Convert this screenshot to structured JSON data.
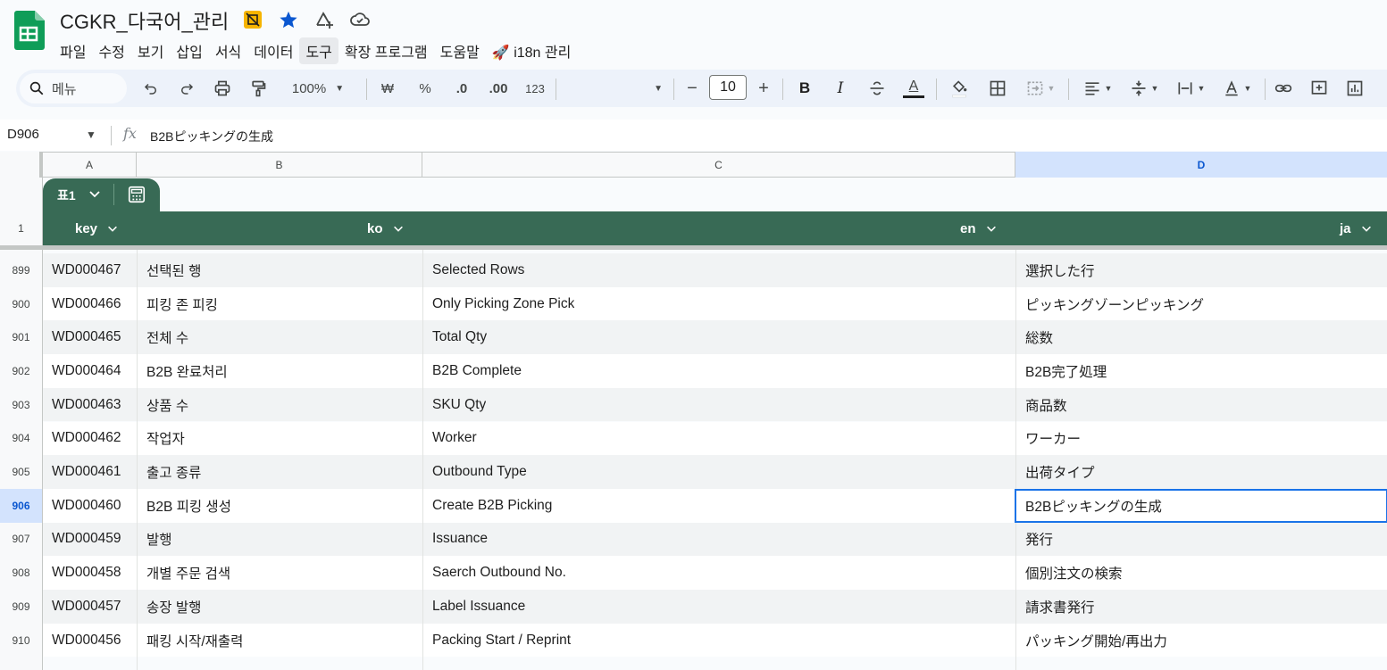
{
  "document": {
    "title": "CGKR_다국어_관리"
  },
  "menu": {
    "items": [
      "파일",
      "수정",
      "보기",
      "삽입",
      "서식",
      "데이터",
      "도구",
      "확장 프로그램",
      "도움말"
    ],
    "addon_label": "i18n 관리"
  },
  "toolbar": {
    "search_label": "메뉴",
    "zoom": "100%",
    "currency": "₩",
    "percent": "%",
    "dec_decrease": ".0",
    "dec_increase": ".00",
    "number_format": "123",
    "font_size": "10",
    "bold": "B",
    "italic": "I",
    "text_color": "A"
  },
  "formula_bar": {
    "cell_ref": "D906",
    "fx": "fx",
    "content": "B2Bピッキングの生成"
  },
  "columns": [
    "A",
    "B",
    "C",
    "D"
  ],
  "table": {
    "name": "표1",
    "header_row_number": "1",
    "headers": [
      "key",
      "ko",
      "en",
      "ja"
    ]
  },
  "rows": [
    {
      "num": "899",
      "key": "WD000467",
      "ko": "선택된 행",
      "en": "Selected Rows",
      "ja": "選択した行"
    },
    {
      "num": "900",
      "key": "WD000466",
      "ko": "피킹 존 피킹",
      "en": "Only Picking Zone Pick",
      "ja": "ピッキングゾーンピッキング"
    },
    {
      "num": "901",
      "key": "WD000465",
      "ko": "전체 수",
      "en": "Total Qty",
      "ja": "総数"
    },
    {
      "num": "902",
      "key": "WD000464",
      "ko": "B2B 완료처리",
      "en": "B2B Complete",
      "ja": "B2B完了処理"
    },
    {
      "num": "903",
      "key": "WD000463",
      "ko": "상품 수",
      "en": "SKU Qty",
      "ja": "商品数"
    },
    {
      "num": "904",
      "key": "WD000462",
      "ko": "작업자",
      "en": "Worker",
      "ja": "ワーカー"
    },
    {
      "num": "905",
      "key": "WD000461",
      "ko": "출고 종류",
      "en": "Outbound Type",
      "ja": "出荷タイプ"
    },
    {
      "num": "906",
      "key": "WD000460",
      "ko": "B2B 피킹 생성",
      "en": "Create B2B Picking",
      "ja": "B2Bピッキングの生成"
    },
    {
      "num": "907",
      "key": "WD000459",
      "ko": "발행",
      "en": "Issuance",
      "ja": "発行"
    },
    {
      "num": "908",
      "key": "WD000458",
      "ko": "개별 주문 검색",
      "en": "Saerch Outbound No.",
      "ja": "個別注文の検索"
    },
    {
      "num": "909",
      "key": "WD000457",
      "ko": "송장 발행",
      "en": "Label Issuance",
      "ja": "請求書発行"
    },
    {
      "num": "910",
      "key": "WD000456",
      "ko": "패킹 시작/재출력",
      "en": "Packing Start / Reprint",
      "ja": "パッキング開始/再出力"
    }
  ],
  "selection": {
    "row": "906",
    "column": "D"
  },
  "colors": {
    "table_header": "#386a55",
    "selection": "#1a73e8",
    "band": "#f1f3f4"
  }
}
